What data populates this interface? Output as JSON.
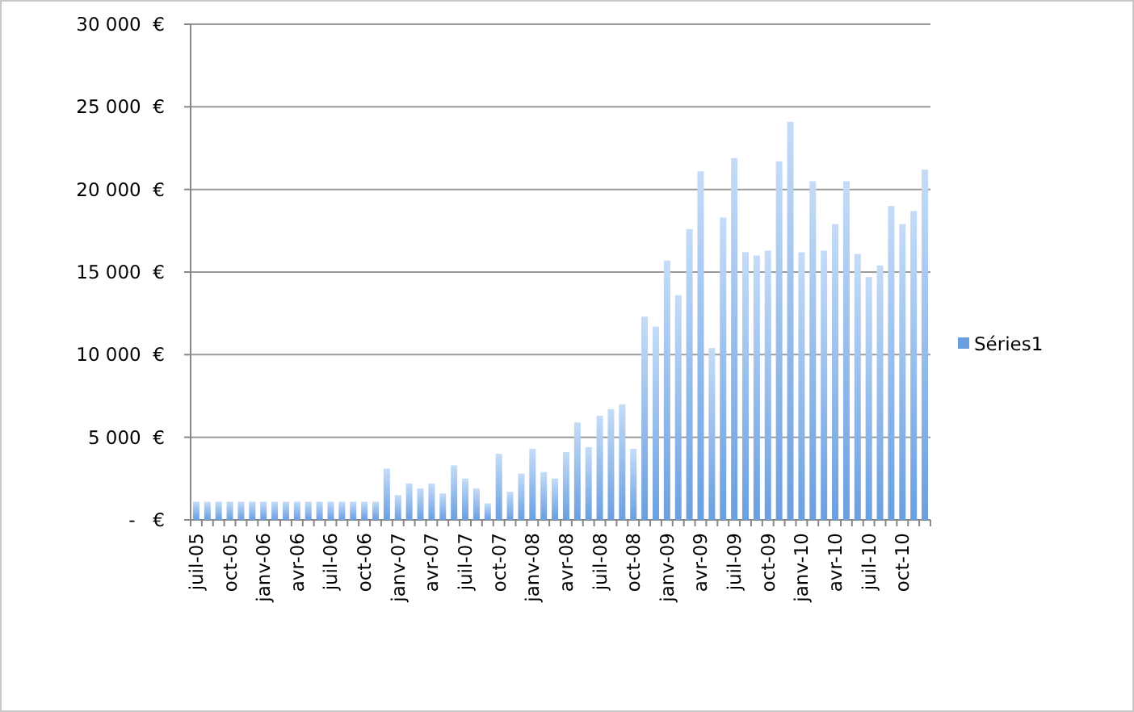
{
  "chart": {
    "chart_data": {
      "type": "bar",
      "grid": true,
      "categories": [
        "juil-05",
        null,
        null,
        "oct-05",
        null,
        null,
        "janv-06",
        null,
        null,
        "avr-06",
        null,
        null,
        "juil-06",
        null,
        null,
        "oct-06",
        null,
        null,
        "janv-07",
        null,
        null,
        "avr-07",
        null,
        null,
        "juil-07",
        null,
        null,
        "oct-07",
        null,
        null,
        "janv-08",
        null,
        null,
        "avr-08",
        null,
        null,
        "juil-08",
        null,
        null,
        "oct-08",
        null,
        null,
        "janv-09",
        null,
        null,
        "avr-09",
        null,
        null,
        "juil-09",
        null,
        null,
        "oct-09",
        null,
        null,
        "janv-10",
        null,
        null,
        "avr-10",
        null,
        null,
        "juil-10",
        null,
        null,
        "oct-10",
        null,
        null
      ],
      "series": [
        {
          "name": "Séries1",
          "color": "#6a9fdf",
          "values": [
            1100,
            1100,
            1100,
            1100,
            1100,
            1100,
            1100,
            1100,
            1100,
            1100,
            1100,
            1100,
            1100,
            1100,
            1100,
            1100,
            1100,
            3100,
            1500,
            2200,
            1900,
            2200,
            1600,
            3300,
            2500,
            1900,
            1000,
            4000,
            1700,
            2800,
            4300,
            2900,
            2500,
            4100,
            5900,
            4400,
            6300,
            6700,
            7000,
            4300,
            12300,
            11700,
            15700,
            13600,
            17600,
            21100,
            10400,
            18300,
            21900,
            16200,
            16000,
            16300,
            21700,
            24100,
            16200,
            20500,
            16300,
            17900,
            20500,
            16100,
            14700,
            15400,
            19000,
            17900,
            18700,
            21200
          ]
        }
      ],
      "ylim": [
        0,
        30000
      ],
      "yticks": [
        {
          "value": 0,
          "label": "-   €"
        },
        {
          "value": 5000,
          "label": "5 000  €"
        },
        {
          "value": 10000,
          "label": "10 000  €"
        },
        {
          "value": 15000,
          "label": "15 000  €"
        },
        {
          "value": 20000,
          "label": "20 000  €"
        },
        {
          "value": 25000,
          "label": "25 000  €"
        },
        {
          "value": 30000,
          "label": "30 000  €"
        }
      ]
    }
  }
}
